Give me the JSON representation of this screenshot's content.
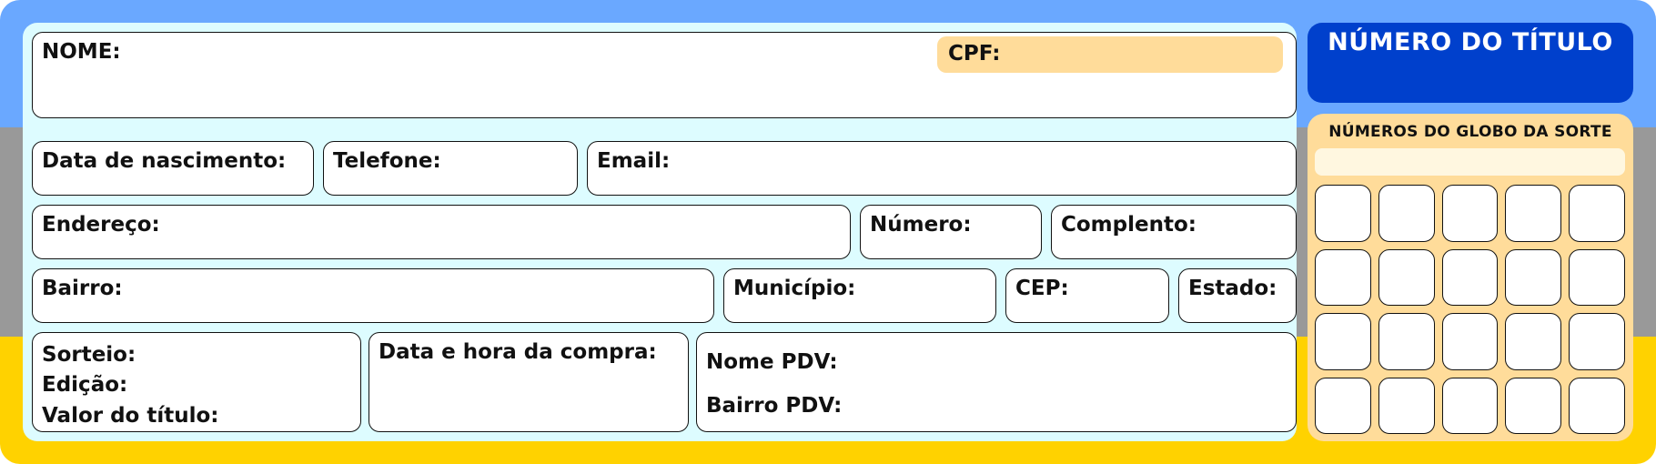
{
  "colors": {
    "band_blue": "#6aa8ff",
    "band_gray": "#999999",
    "band_yellow": "#ffd200",
    "panel_bg": "#ddfcff",
    "cpf_bg": "#ffdc9a",
    "title_bg": "#0040cc",
    "globo_bg": "#ffdc9a",
    "globo_strip_bg": "#fff7e0"
  },
  "form": {
    "nome": "NOME:",
    "cpf": "CPF:",
    "nascimento": "Data de nascimento:",
    "telefone": "Telefone:",
    "email": "Email:",
    "endereco": "Endereço:",
    "numero": "Número:",
    "complemento": "Complento:",
    "bairro": "Bairro:",
    "municipio": "Município:",
    "cep": "CEP:",
    "estado": "Estado:",
    "sorteio": "Sorteio:",
    "edicao": "Edição:",
    "valor": "Valor do título:",
    "data_compra": "Data e hora da compra:",
    "nome_pdv": "Nome PDV:",
    "bairro_pdv": "Bairro PDV:"
  },
  "title": {
    "label": "NÚMERO DO TÍTULO"
  },
  "globo": {
    "title": "NÚMEROS DO GLOBO DA SORTE",
    "cells": [
      "",
      "",
      "",
      "",
      "",
      "",
      "",
      "",
      "",
      "",
      "",
      "",
      "",
      "",
      "",
      "",
      "",
      "",
      "",
      ""
    ]
  }
}
